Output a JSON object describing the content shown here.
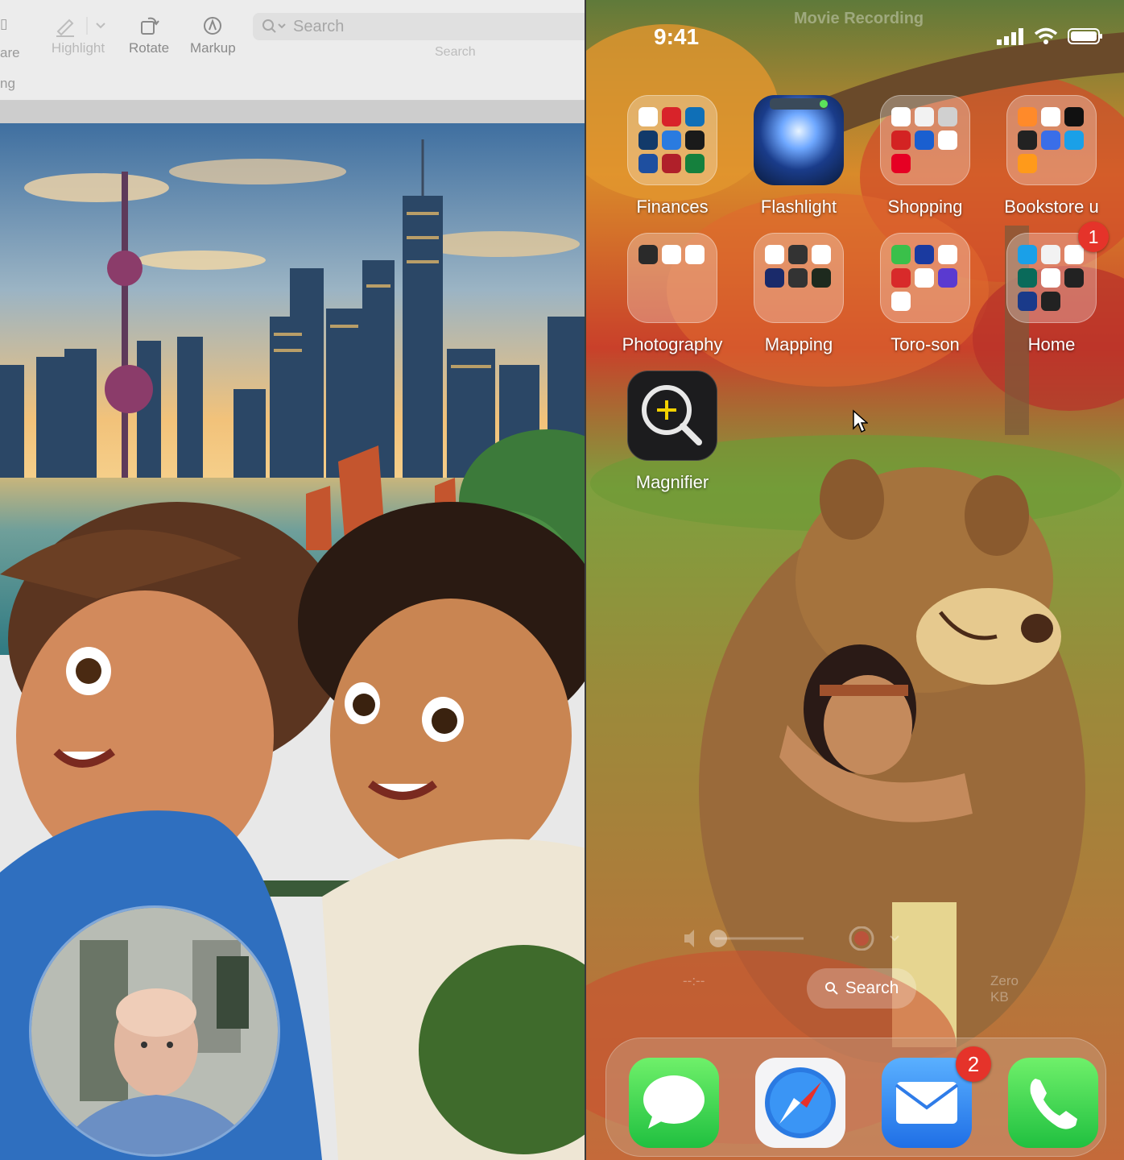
{
  "preview_window": {
    "toolbar": {
      "share_label_cut": "are",
      "highlight_label": "Highlight",
      "rotate_label": "Rotate",
      "markup_label": "Markup",
      "search_placeholder": "Search",
      "search_label": "Search",
      "second_row_cut": "ng"
    }
  },
  "phone": {
    "status": {
      "time": "9:41",
      "recording_title": "Movie Recording"
    },
    "apps": [
      {
        "name": "Finances",
        "kind": "folder"
      },
      {
        "name": "Flashlight",
        "kind": "app"
      },
      {
        "name": "Shopping",
        "kind": "folder"
      },
      {
        "name": "Bookstore u",
        "kind": "folder"
      },
      {
        "name": "Photography",
        "kind": "folder"
      },
      {
        "name": "Mapping",
        "kind": "folder"
      },
      {
        "name": "Toro-son",
        "kind": "folder"
      },
      {
        "name": "Home",
        "kind": "folder",
        "badge": "1"
      },
      {
        "name": "Magnifier",
        "kind": "app"
      }
    ],
    "recording_controls": {
      "time": "--:--",
      "size": "Zero KB"
    },
    "search_pill": "Search",
    "dock": [
      {
        "name": "Messages",
        "icon": "messages-icon"
      },
      {
        "name": "Safari",
        "icon": "safari-icon"
      },
      {
        "name": "Mail",
        "icon": "mail-icon",
        "badge": "2"
      },
      {
        "name": "Phone",
        "icon": "phone-icon"
      }
    ]
  }
}
